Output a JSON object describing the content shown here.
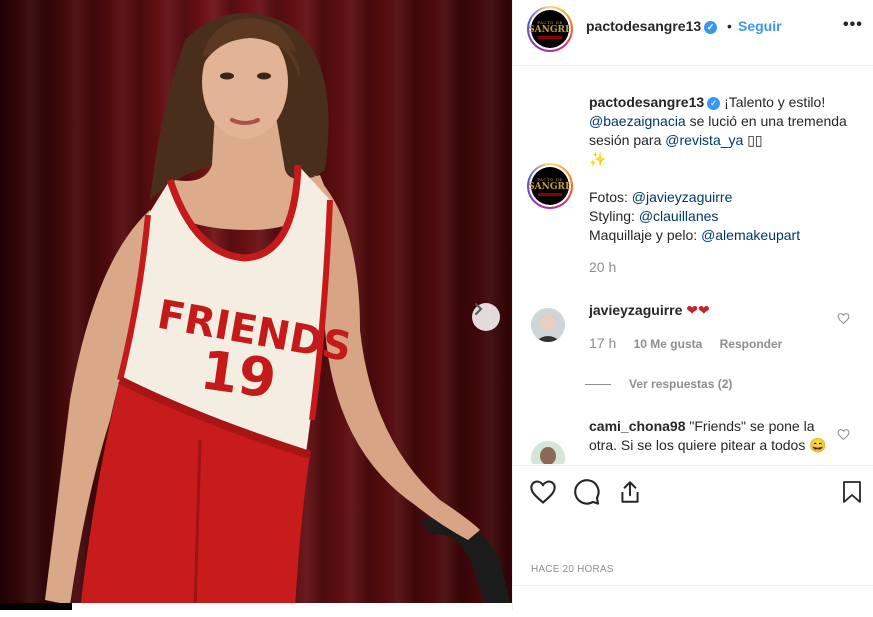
{
  "post": {
    "username": "pactodesangre13",
    "follow_label": "Seguir",
    "dot": "•",
    "more_label": "•••",
    "verified_mark": "✓",
    "logo_text_top": "PACTO DE",
    "logo_text_main": "SANGRE",
    "timestamp": "HACE 20 HORAS"
  },
  "photo": {
    "shirt_word": "FRIENDS",
    "shirt_number": "19"
  },
  "caption": {
    "username": "pactodesangre13",
    "text_1": "¡Talento y estilo!",
    "mention_1": "@baezaignacia",
    "text_2": " se lució en una tremenda sesión para ",
    "mention_2": "@revista_ya",
    "text_3": " ▯▯",
    "sparkle": "✨",
    "fotos_label": "Fotos: ",
    "fotos_mention": "@javieyzaguirre",
    "styling_label": "Styling: ",
    "styling_mention": "@clauillanes",
    "makeup_label": "Maquillaje y pelo: ",
    "makeup_mention": "@alemakeupart",
    "time": "20 h"
  },
  "comments": [
    {
      "username": "javieyzaguirre",
      "text": "❤❤",
      "time": "17 h",
      "likes": "10 Me gusta",
      "reply": "Responder",
      "view_replies": "Ver respuestas (2)"
    },
    {
      "username": "cami_chona98",
      "text": "\"Friends\" se pone la otra. Si se los quiere pitear a todos 😄"
    }
  ],
  "colors": {
    "link_blue": "#3897f0",
    "mention": "#00376b",
    "muted": "#8e8e8e",
    "shirt_red": "#c41a1a"
  },
  "icons": [
    "heart-icon",
    "comment-icon",
    "share-icon",
    "bookmark-icon",
    "chevron-right-icon",
    "verified-icon"
  ]
}
